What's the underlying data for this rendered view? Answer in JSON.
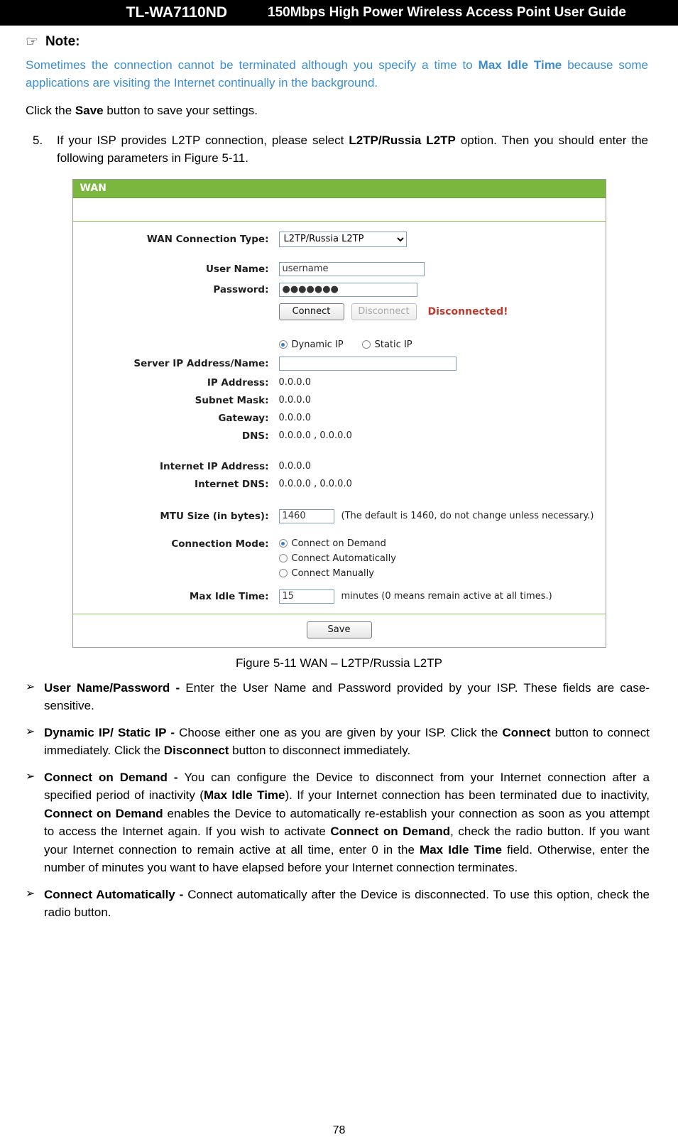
{
  "header": {
    "model": "TL-WA7110ND",
    "title": "150Mbps High Power Wireless Access Point User Guide"
  },
  "note": {
    "icon": "pointing-hand-icon",
    "label": "Note:",
    "text_1": "Sometimes the connection cannot be terminated although you specify a time to ",
    "text_bold": "Max Idle Time",
    "text_2": " because some applications are visiting the Internet continually in the background."
  },
  "save_hint": {
    "before": "Click the ",
    "bold": "Save",
    "after": " button to save your settings."
  },
  "step": {
    "number": "5.",
    "text_1": "If your ISP provides L2TP connection, please select ",
    "bold": "L2TP/Russia L2TP",
    "text_2": " option. Then you should enter the following parameters in Figure 5-11."
  },
  "wan": {
    "panel_title": "WAN",
    "labels": {
      "wan_connection_type": "WAN Connection Type:",
      "user_name": "User Name:",
      "password": "Password:",
      "server_ip": "Server IP Address/Name:",
      "ip_address": "IP Address:",
      "subnet_mask": "Subnet Mask:",
      "gateway": "Gateway:",
      "dns": "DNS:",
      "internet_ip": "Internet IP Address:",
      "internet_dns": "Internet DNS:",
      "mtu_size": "MTU Size (in bytes):",
      "connection_mode": "Connection Mode:",
      "max_idle_time": "Max Idle Time:"
    },
    "connection_type": {
      "selected": "L2TP/Russia L2TP",
      "options": [
        "L2TP/Russia L2TP"
      ]
    },
    "user_name_value": "username",
    "password_value": "●●●●●●●",
    "buttons": {
      "connect": "Connect",
      "disconnect": "Disconnect",
      "save": "Save"
    },
    "status": "Disconnected!",
    "ip_mode": {
      "dynamic": "Dynamic IP",
      "static": "Static IP",
      "selected": "Dynamic IP"
    },
    "server_ip_value": "",
    "values": {
      "ip_address": "0.0.0.0",
      "subnet_mask": "0.0.0.0",
      "gateway": "0.0.0.0",
      "dns": "0.0.0.0 , 0.0.0.0",
      "internet_ip": "0.0.0.0",
      "internet_dns": "0.0.0.0 , 0.0.0.0"
    },
    "mtu_value": "1460",
    "mtu_hint": "(The default is 1460, do not change unless necessary.)",
    "connection_modes": [
      {
        "label": "Connect on Demand",
        "checked": true
      },
      {
        "label": "Connect Automatically",
        "checked": false
      },
      {
        "label": "Connect Manually",
        "checked": false
      }
    ],
    "max_idle_value": "15",
    "max_idle_hint": "minutes (0 means remain active at all times.)"
  },
  "figure_caption": "Figure 5-11 WAN – L2TP/Russia L2TP",
  "bullets": [
    {
      "mark": "➢",
      "bold_lead": "User Name/Password - ",
      "text": "Enter the User Name and Password provided by your ISP. These fields are case-sensitive."
    },
    {
      "mark": "➢",
      "bold_lead": "Dynamic IP/ Static IP - ",
      "text_1": "Choose either one as you are given by your ISP. Click the ",
      "bold_1": "Connect",
      "text_2": " button to connect immediately. Click the ",
      "bold_2": "Disconnect",
      "text_3": " button to disconnect immediately."
    },
    {
      "mark": "➢",
      "bold_lead": "Connect on Demand - ",
      "t1": "You can configure the Device to disconnect from your  Internet connection after a specified period of inactivity (",
      "b1": "Max Idle Time",
      "t2": "). If your Internet connection has  been  terminated  due  to  inactivity, ",
      "b2": "Connect on Demand",
      "t3": "  enables  the  Device  to automatically re-establish your connection as soon  as  you  attempt  to  access  the  Internet again. If you wish to activate ",
      "b3": "Connect on Demand",
      "t4": ", check the radio button. If you want your Internet connection to remain active at all time, enter 0 in the ",
      "b4": "Max Idle Time",
      "t5": " field. Otherwise, enter   the   number   of   minutes   you   want   to   have   elapsed   before   your   Internet   connection terminates."
    },
    {
      "mark": "➢",
      "bold_lead": "Connect Automatically - ",
      "text": "Connect automatically after the Device is disconnected. To use this option, check the radio button."
    }
  ],
  "page_number": "78"
}
